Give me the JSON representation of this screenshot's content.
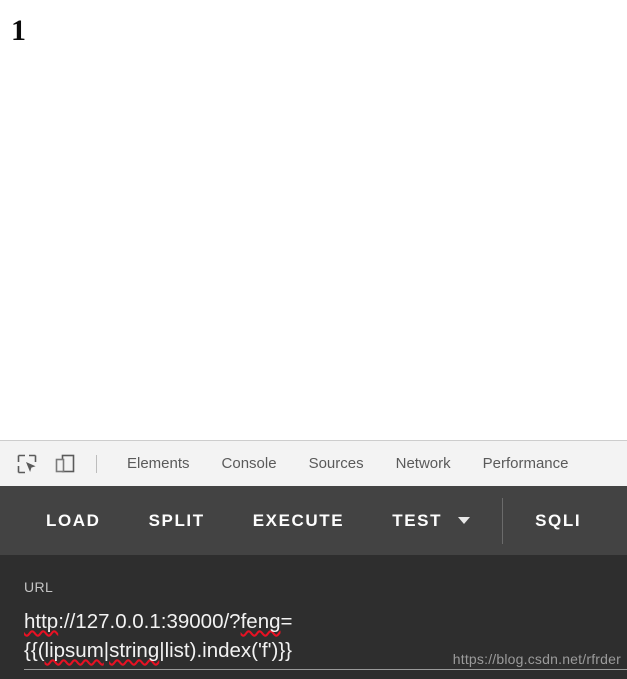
{
  "page": {
    "heading": "1"
  },
  "devtools": {
    "icons": [
      {
        "name": "inspect-element-icon",
        "title": "Inspect element"
      },
      {
        "name": "device-toolbar-icon",
        "title": "Toggle device toolbar"
      }
    ],
    "tabs": [
      {
        "label": "Elements"
      },
      {
        "label": "Console"
      },
      {
        "label": "Sources"
      },
      {
        "label": "Network"
      },
      {
        "label": "Performance"
      }
    ]
  },
  "toolbar": {
    "load_label": "LOAD",
    "split_label": "SPLIT",
    "execute_label": "EXECUTE",
    "test_label": "TEST",
    "test_caret_icon": "chevron-down-icon",
    "sqli_label": "SQLI",
    "background_color": "#434343",
    "text_color": "#fdfdfd"
  },
  "url_panel": {
    "label": "URL",
    "value_line1": "http://127.0.0.1:39000/?feng=",
    "value_line2": "{{(lipsum|string|list).index('f')}}",
    "value_full": "http://127.0.0.1:39000/?feng={{(lipsum|string|list).index('f')}}",
    "placeholder": "URL",
    "spellcheck_words": [
      "http",
      "feng",
      "lipsum",
      "string"
    ],
    "spellcheck_color": "#e81123",
    "background_color": "#2e2e2e"
  },
  "watermark": {
    "text": "https://blog.csdn.net/rfrder"
  }
}
